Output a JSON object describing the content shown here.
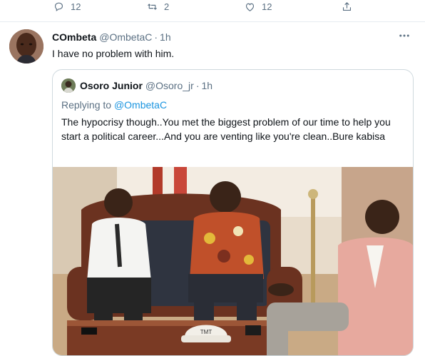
{
  "actions": {
    "reply_count": "12",
    "retweet_count": "2",
    "like_count": "12"
  },
  "tweet": {
    "name": "COmbeta",
    "handle": "@OmbetaC",
    "separator": "·",
    "time": "1h",
    "text": "I have no problem with him.",
    "more_icon": "more-horizontal-icon"
  },
  "quote": {
    "name": "Osoro Junior",
    "handle": "@Osoro_jr",
    "separator": "·",
    "time": "1h",
    "replying_label": "Replying to",
    "replying_mention": "@OmbetaC",
    "text": "The hypocrisy though..You met the biggest problem of our time to help you start a political career...And you are venting like you're clean..Bure kabisa",
    "photo_cap_text": "TMT"
  },
  "colors": {
    "secondary_text": "#5b7083",
    "link": "#1b95e0",
    "border": "#cfd9de"
  }
}
